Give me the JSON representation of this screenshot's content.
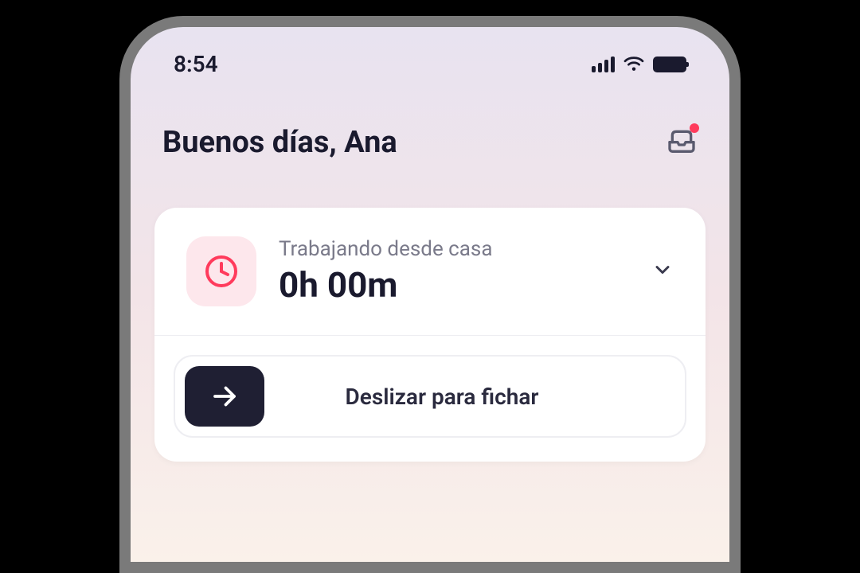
{
  "statusBar": {
    "time": "8:54"
  },
  "header": {
    "greeting": "Buenos días, Ana"
  },
  "workCard": {
    "statusLabel": "Trabajando desde casa",
    "timeDisplay": "0h 00m"
  },
  "slider": {
    "label": "Deslizar para fichar"
  },
  "colors": {
    "accent": "#ff3b5c",
    "darkText": "#1a1a2e",
    "grayText": "#7a7a8a",
    "clockBadge": "#fde7ec",
    "sliderHandle": "#1f1f33"
  }
}
